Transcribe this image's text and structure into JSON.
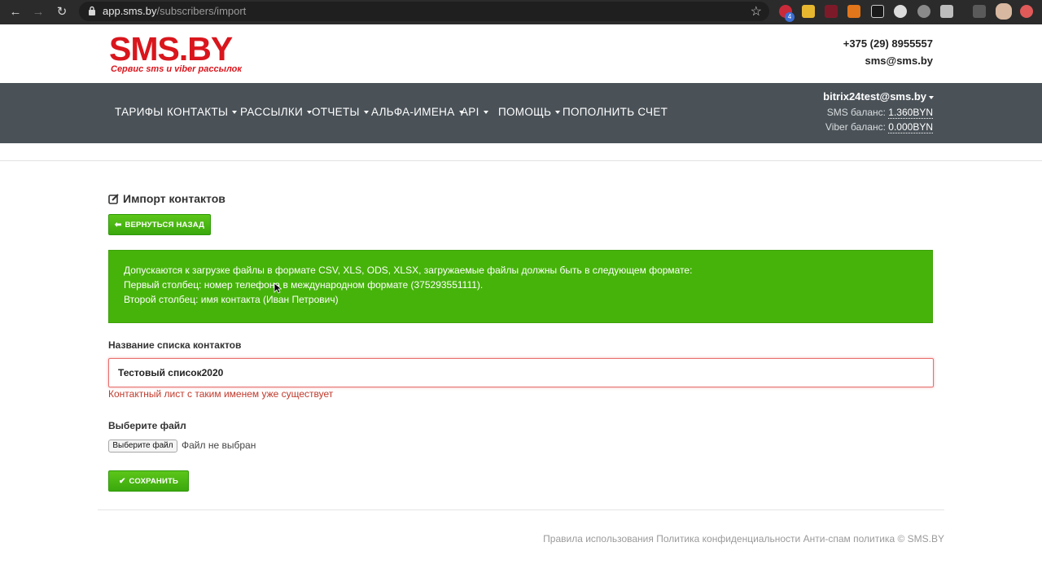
{
  "browser": {
    "url_host": "app.sms.by",
    "url_path": "/subscribers/import",
    "extension_badge": "4"
  },
  "header": {
    "logo_text": "SMS.BY",
    "logo_tagline": "Сервис sms и viber рассылок",
    "phone": "+375 (29) 8955557",
    "email": "sms@sms.by"
  },
  "nav": {
    "items": [
      {
        "label": "ТАРИФЫ",
        "dropdown": false
      },
      {
        "label": "КОНТАКТЫ",
        "dropdown": true
      },
      {
        "label": "РАССЫЛКИ",
        "dropdown": true
      },
      {
        "label": "ОТЧЕТЫ",
        "dropdown": true
      },
      {
        "label": "АЛЬФА-ИМЕНА",
        "dropdown": true
      },
      {
        "label": "API",
        "dropdown": true
      },
      {
        "label": "ПОМОЩЬ",
        "dropdown": true
      },
      {
        "label": "ПОПОЛНИТЬ СЧЕТ",
        "dropdown": false
      }
    ],
    "account": "bitrix24test@sms.by",
    "sms_balance_label": "SMS баланс:",
    "sms_balance_value": "1.360BYN",
    "viber_balance_label": "Viber баланс:",
    "viber_balance_value": "0.000BYN"
  },
  "page": {
    "title": "Импорт контактов",
    "back_button": "ВЕРНУТЬСЯ НАЗАД",
    "info_lines": [
      "Допускаются к загрузке файлы в формате CSV, XLS, ODS, XLSX, загружаемые файлы должны быть в следующем формате:",
      "Первый столбец: номер телефона в международном формате (375293551111).",
      "Второй столбец: имя контакта (Иван Петрович)"
    ],
    "list_name_label": "Название списка контактов",
    "list_name_value": "Тестовый список2020",
    "list_name_error": "Контактный лист с таким именем уже существует",
    "file_label": "Выберите файл",
    "file_button": "Выберите файл",
    "file_status": "Файл не выбран",
    "save_button": "СОХРАНИТЬ"
  },
  "footer": {
    "text": "Правила использования Политика конфиденциальности Анти-спам политика © SMS.BY"
  },
  "colors": {
    "brand_red": "#d9161d",
    "nav_bg": "#4a5258",
    "success_green": "#46b30a",
    "error_red": "#c0392b"
  }
}
